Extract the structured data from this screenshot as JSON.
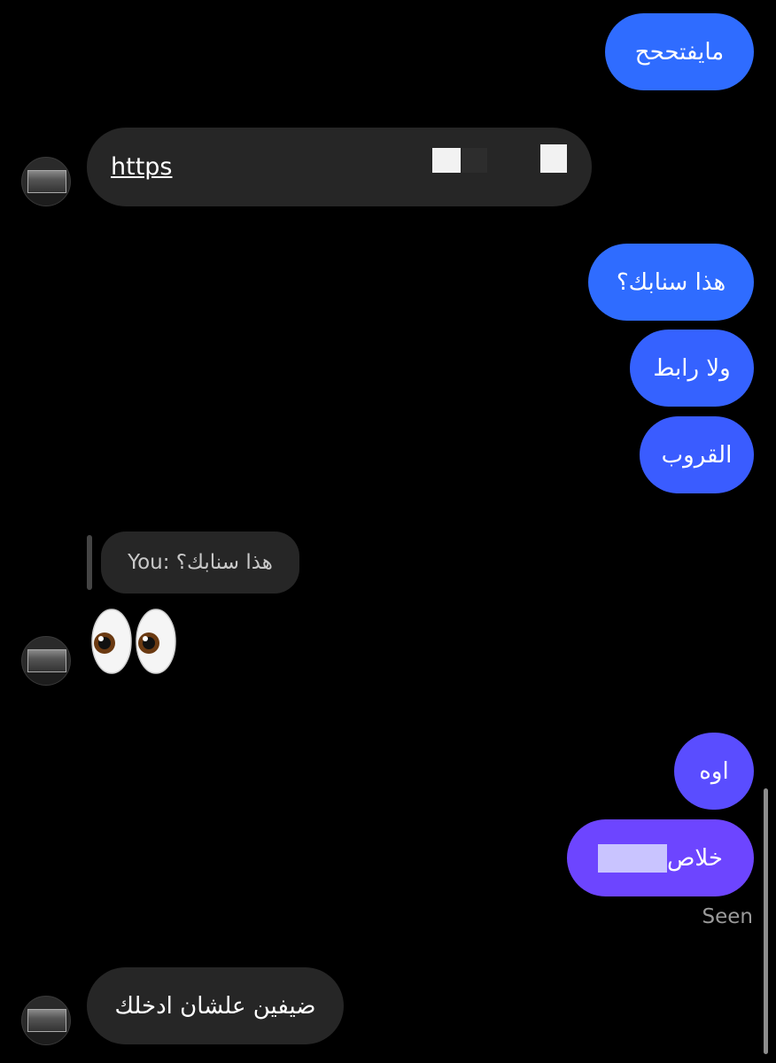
{
  "messages": {
    "m1": "مايفتححح",
    "link": "https",
    "m2": "هذا سنابك؟",
    "m3": "ولا رابط",
    "m4": "القروب",
    "reply_quote": "You: هذا سنابك؟",
    "eyes_emoji": "👀",
    "m5": "اوه",
    "m6": "خلاص",
    "m7": "ضيفين علشان ادخلك"
  },
  "status": {
    "seen": "Seen"
  },
  "colors": {
    "outgoing_blue": "#2f6cff",
    "outgoing_indigo": "#4a52ff",
    "outgoing_purple": "#6d45ff",
    "incoming": "#262626"
  },
  "icons": {
    "contact_avatar": "avatar-image",
    "reply_indicator": "reply-bar"
  }
}
